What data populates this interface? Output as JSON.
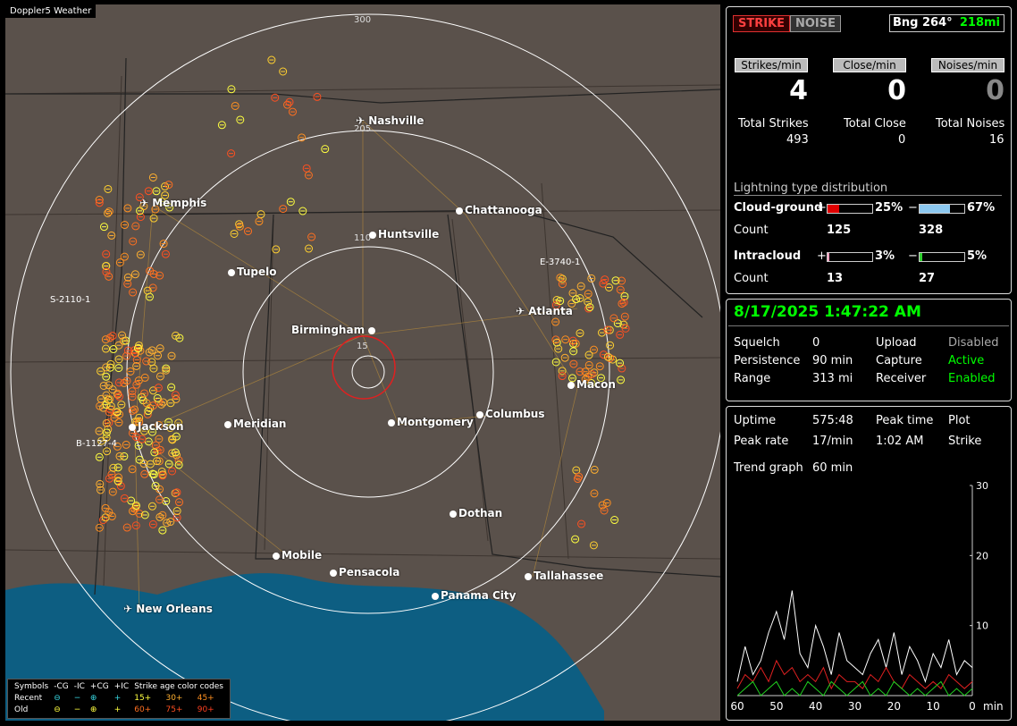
{
  "map": {
    "title": "Doppler5 Weather",
    "ring_labels": [
      "300",
      "205",
      "110",
      "15"
    ],
    "cities": [
      "Nashville",
      "Memphis",
      "Chattanooga",
      "Huntsville",
      "Tupelo",
      "Atlanta",
      "Birmingham",
      "Macon",
      "Jackson",
      "Meridian",
      "Montgomery",
      "Columbus",
      "Dothan",
      "Mobile",
      "Pensacola",
      "Tallahassee",
      "Panama City",
      "New Orleans"
    ],
    "storm_labels": [
      "E-3740-1",
      "S-2110-1",
      "B-1127-4"
    ]
  },
  "legend": {
    "header": [
      "Symbols",
      "-CG",
      "-IC",
      "+CG",
      "+IC",
      "Strike age color codes"
    ],
    "recent": [
      "Recent",
      "⊖",
      "−",
      "⊕",
      "+",
      "15+",
      "30+",
      "45+"
    ],
    "old": [
      "Old",
      "⊖",
      "−",
      "⊕",
      "+",
      "60+",
      "75+",
      "90+"
    ]
  },
  "panel1": {
    "strike_btn": "STRIKE",
    "noise_btn": "NOISE",
    "bearing": "Bng 264°",
    "distance": "218mi",
    "tabs": [
      "Strikes/min",
      "Close/min",
      "Noises/min"
    ],
    "rates": [
      "4",
      "0",
      "0"
    ],
    "totals_labels": [
      "Total Strikes",
      "Total Close",
      "Total Noises"
    ],
    "totals_values": [
      "493",
      "0",
      "16"
    ],
    "dist_title": "Lightning type distribution",
    "cg_label": "Cloud-ground",
    "ic_label": "Intracloud",
    "plus": "+",
    "minus": "−",
    "cg_pos_pct": "25%",
    "cg_neg_pct": "67%",
    "ic_pos_pct": "3%",
    "ic_neg_pct": "5%",
    "count_label": "Count",
    "cg_pos_count": "125",
    "cg_neg_count": "328",
    "ic_pos_count": "13",
    "ic_neg_count": "27",
    "cg_pos_frac": 0.25,
    "cg_neg_frac": 0.67,
    "ic_pos_frac": 0.03,
    "ic_neg_frac": 0.05
  },
  "panel2": {
    "datetime": "8/17/2025 1:47:22 AM",
    "squelch_label": "Squelch",
    "squelch": "0",
    "persistence_label": "Persistence",
    "persistence": "90 min",
    "range_label": "Range",
    "range": "313 mi",
    "upload_label": "Upload",
    "upload": "Disabled",
    "capture_label": "Capture",
    "capture": "Active",
    "receiver_label": "Receiver",
    "receiver": "Enabled"
  },
  "panel3": {
    "uptime_label": "Uptime",
    "uptime": "575:48",
    "peak_time_label": "Peak time",
    "plot_label": "Plot",
    "peak_rate_label": "Peak rate",
    "peak_rate": "17/min",
    "peak_time": "1:02 AM",
    "plot": "Strike",
    "trend_label": "Trend graph",
    "trend": "60 min",
    "y_ticks": [
      "30",
      "20",
      "10"
    ],
    "x_ticks": [
      "60",
      "50",
      "40",
      "30",
      "20",
      "10",
      "0"
    ],
    "x_unit": "min"
  },
  "chart_data": {
    "type": "line",
    "x": [
      60,
      58,
      56,
      54,
      52,
      50,
      48,
      46,
      44,
      42,
      40,
      38,
      36,
      34,
      32,
      30,
      28,
      26,
      24,
      22,
      20,
      18,
      16,
      14,
      12,
      10,
      8,
      6,
      4,
      2,
      0
    ],
    "series": [
      {
        "values": [
          2,
          7,
          3,
          5,
          9,
          12,
          8,
          15,
          6,
          4,
          10,
          7,
          3,
          9,
          5,
          4,
          3,
          6,
          8,
          4,
          9,
          3,
          7,
          5,
          2,
          6,
          4,
          8,
          3,
          5,
          4
        ]
      },
      {
        "values": [
          1,
          3,
          2,
          4,
          2,
          5,
          3,
          4,
          2,
          3,
          2,
          4,
          1,
          3,
          2,
          2,
          1,
          3,
          2,
          4,
          2,
          1,
          3,
          2,
          1,
          2,
          1,
          3,
          2,
          1,
          2
        ]
      },
      {
        "values": [
          0,
          1,
          2,
          0,
          1,
          2,
          0,
          1,
          0,
          2,
          1,
          0,
          2,
          1,
          0,
          1,
          2,
          0,
          1,
          0,
          2,
          1,
          0,
          1,
          0,
          1,
          2,
          0,
          1,
          0,
          1
        ]
      }
    ],
    "ylim": [
      0,
      30
    ],
    "xlim": [
      60,
      0
    ]
  }
}
